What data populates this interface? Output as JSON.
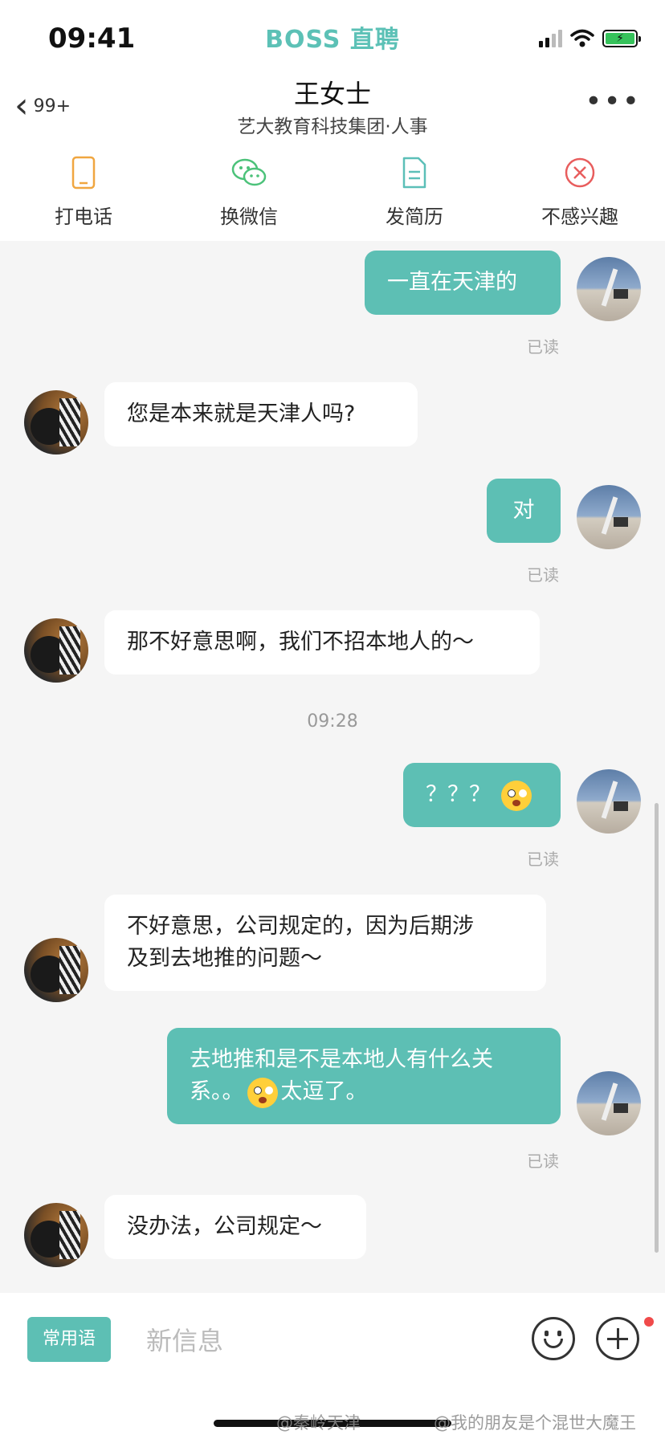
{
  "status_bar": {
    "time": "09:41",
    "brand": "BOSS 直聘"
  },
  "header": {
    "unread_count": "99+",
    "contact_name": "王女士",
    "company": "艺大教育科技集团·人事",
    "more_icon": "more-dots-icon"
  },
  "actions": [
    {
      "label": "打电话",
      "icon": "phone-icon"
    },
    {
      "label": "换微信",
      "icon": "wechat-icon"
    },
    {
      "label": "发简历",
      "icon": "resume-icon"
    },
    {
      "label": "不感兴趣",
      "icon": "not-interested-icon"
    }
  ],
  "colors": {
    "brand": "#5cc1b6",
    "my_bubble": "#5dbfb4",
    "not_interested": "#e85d5d",
    "phone": "#f0a640",
    "wechat": "#4cc27a",
    "resume": "#5cbfb8"
  },
  "messages": [
    {
      "sender": "me",
      "text": "一直在天津的",
      "status": "已读"
    },
    {
      "sender": "hr",
      "text": "您是本来就是天津人吗?"
    },
    {
      "sender": "me",
      "text": "对",
      "status": "已读"
    },
    {
      "sender": "hr",
      "text": "那不好意思啊，我们不招本地人的～"
    },
    {
      "sender": "me",
      "text": "？？？",
      "status": "已读",
      "emoji": "astonished-face"
    },
    {
      "sender": "hr",
      "text_line1": "不好意思，公司规定的，因为后期涉",
      "text_line2": "及到去地推的问题～"
    },
    {
      "sender": "me",
      "text_line1": "去地推和是不是本地人有什么关",
      "text_line2_before": "系。。",
      "text_line2_after": "太逗了。",
      "status": "已读",
      "emoji": "astonished-face"
    },
    {
      "sender": "hr",
      "text": "没办法，公司规定～"
    }
  ],
  "timestamp": "09:28",
  "input_bar": {
    "common_phrases": "常用语",
    "placeholder": "新信息"
  },
  "watermarks": [
    "@秦岭天津",
    "@我的朋友是个混世大魔王"
  ]
}
